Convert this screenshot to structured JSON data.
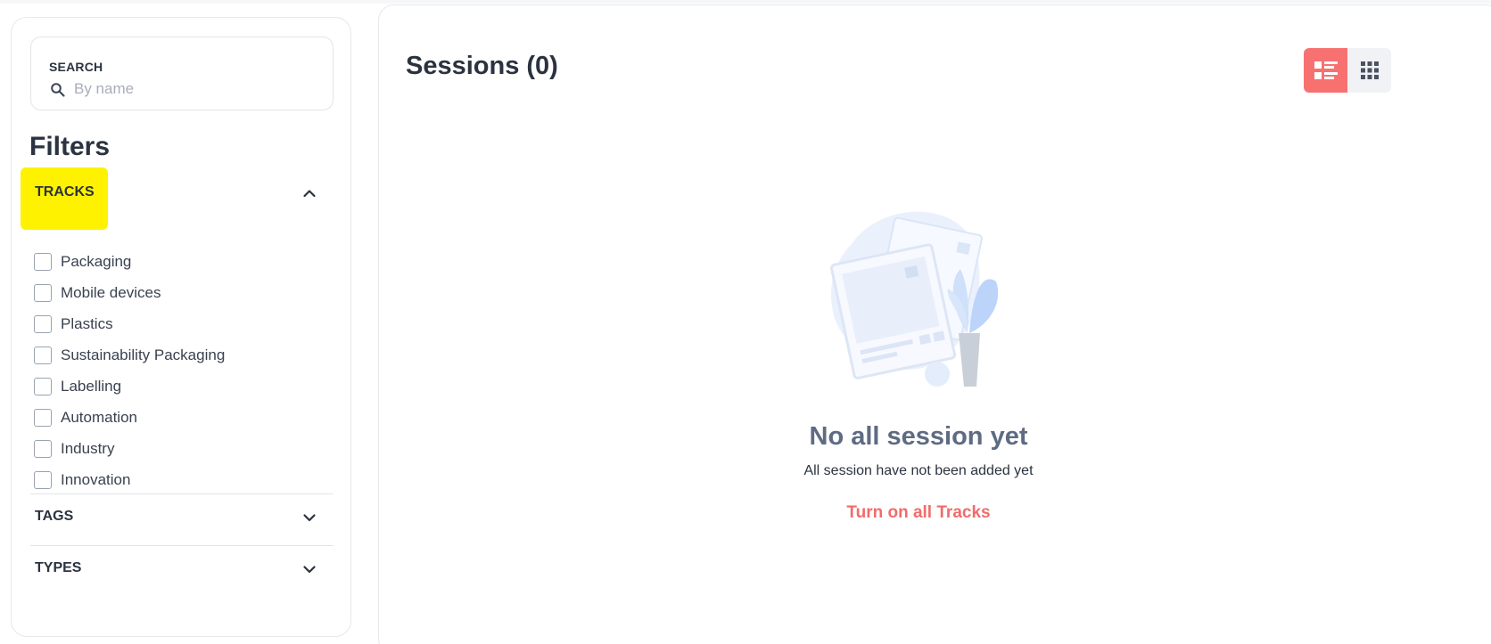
{
  "sidebar": {
    "search": {
      "label": "SEARCH",
      "placeholder": "By name",
      "value": "",
      "icon": "search-icon"
    },
    "filters_title": "Filters",
    "sections": [
      {
        "label": "TRACKS",
        "expanded": true,
        "icon": "chevron-up-icon",
        "items": [
          {
            "label": "Packaging",
            "checked": false
          },
          {
            "label": "Mobile devices",
            "checked": false
          },
          {
            "label": "Plastics",
            "checked": false
          },
          {
            "label": "Sustainability Packaging",
            "checked": false
          },
          {
            "label": "Labelling",
            "checked": false
          },
          {
            "label": "Automation",
            "checked": false
          },
          {
            "label": "Industry",
            "checked": false
          },
          {
            "label": "Innovation",
            "checked": false
          }
        ]
      },
      {
        "label": "TAGS",
        "expanded": false,
        "icon": "chevron-down-icon"
      },
      {
        "label": "TYPES",
        "expanded": false,
        "icon": "chevron-down-icon"
      }
    ]
  },
  "main": {
    "title": "Sessions (0)",
    "view_toggle": {
      "active": "list",
      "options": [
        "list-view-icon",
        "grid-view-icon"
      ]
    },
    "empty_state": {
      "title": "No all session yet",
      "subtitle": "All session have not been added yet",
      "action": "Turn on all Tracks"
    }
  },
  "colors": {
    "accent": "#f87171",
    "action_text": "#f26b6b",
    "highlight": "#fff200",
    "empty_title": "#5e6b82",
    "text": "#2b3340"
  }
}
